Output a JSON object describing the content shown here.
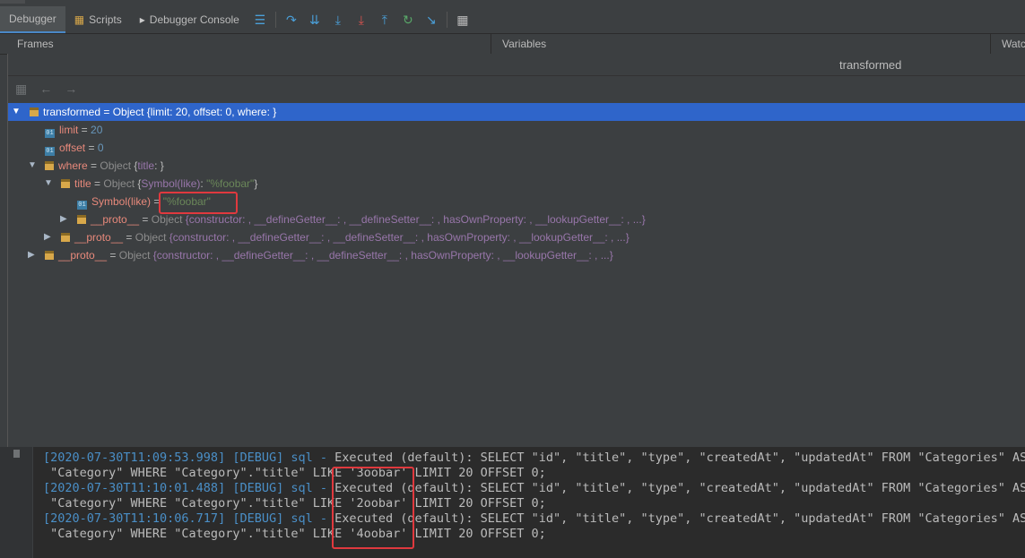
{
  "toolbar": {
    "tabs": [
      {
        "label": "Debugger",
        "icon": "debugger-icon",
        "active": true
      },
      {
        "label": "Scripts",
        "icon": "scripts-icon",
        "active": false
      },
      {
        "label": "Debugger Console",
        "icon": "console-icon",
        "active": false
      }
    ],
    "actions": [
      "menu-icon",
      "show-execution-point-icon",
      "step-over-icon",
      "step-into-icon",
      "force-step-into-icon",
      "step-out-icon",
      "restart-frame-icon",
      "run-to-cursor-icon",
      "evaluate-expression-icon"
    ]
  },
  "panels": {
    "frames": "Frames",
    "variables": "Variables",
    "watches": "Watc"
  },
  "popup": {
    "title": "transformed",
    "tree": [
      {
        "name": "transformed",
        "eq": " = ",
        "type": "Object ",
        "summary": "{limit: 20, offset: 0, where: }",
        "selected": true
      },
      {
        "name": "limit",
        "eq": " = ",
        "value": "20"
      },
      {
        "name": "offset",
        "eq": " = ",
        "value": "0"
      },
      {
        "name": "where",
        "eq": " = ",
        "type": "Object ",
        "summary_open": "{",
        "summary_key": "title",
        "summary_close": ": }"
      },
      {
        "name": "title",
        "eq": " = ",
        "type": "Object ",
        "summary_open": "{",
        "summary_key": "Symbol(like)",
        "summary_mid": ": ",
        "summary_val": "\"%foobar\"",
        "summary_close": "}"
      },
      {
        "name": "Symbol(like)",
        "eq": " = ",
        "value": "\"%foobar\""
      },
      {
        "name": "__proto__",
        "eq": " = ",
        "type": "Object ",
        "summary": "{constructor: , __defineGetter__: , __defineSetter__: , hasOwnProperty: , __lookupGetter__: , ...}"
      },
      {
        "name": "__proto__",
        "eq": " = ",
        "type": "Object ",
        "summary": "{constructor: , __defineGetter__: , __defineSetter__: , hasOwnProperty: , __lookupGetter__: , ...}"
      },
      {
        "name": "__proto__",
        "eq": " = ",
        "type": "Object ",
        "summary": "{constructor: , __defineGetter__: , __defineSetter__: , hasOwnProperty: , __lookupGetter__: , ...}"
      }
    ]
  },
  "console": {
    "lines": [
      {
        "ts": "[2020-07-30T11:09:53.998]",
        "level": " [DEBUG] sql - ",
        "text": "Executed (default): SELECT \"id\", \"title\", \"type\", \"createdAt\", \"updatedAt\" FROM \"Categories\" AS"
      },
      {
        "ts": "",
        "level": "",
        "text": " \"Category\" WHERE \"Category\".\"title\" LIKE '3oobar' LIMIT 20 OFFSET 0;"
      },
      {
        "ts": "[2020-07-30T11:10:01.488]",
        "level": " [DEBUG] sql - ",
        "text": "Executed (default): SELECT \"id\", \"title\", \"type\", \"createdAt\", \"updatedAt\" FROM \"Categories\" AS"
      },
      {
        "ts": "",
        "level": "",
        "text": " \"Category\" WHERE \"Category\".\"title\" LIKE '2oobar' LIMIT 20 OFFSET 0;"
      },
      {
        "ts": "[2020-07-30T11:10:06.717]",
        "level": " [DEBUG] sql - ",
        "text": "Executed (default): SELECT \"id\", \"title\", \"type\", \"createdAt\", \"updatedAt\" FROM \"Categories\" AS"
      },
      {
        "ts": "",
        "level": "",
        "text": " \"Category\" WHERE \"Category\".\"title\" LIKE '4oobar' LIMIT 20 OFFSET 0;"
      }
    ]
  },
  "colors": {
    "accent": "#2f65ca",
    "highlight_box": "#e0393e"
  }
}
